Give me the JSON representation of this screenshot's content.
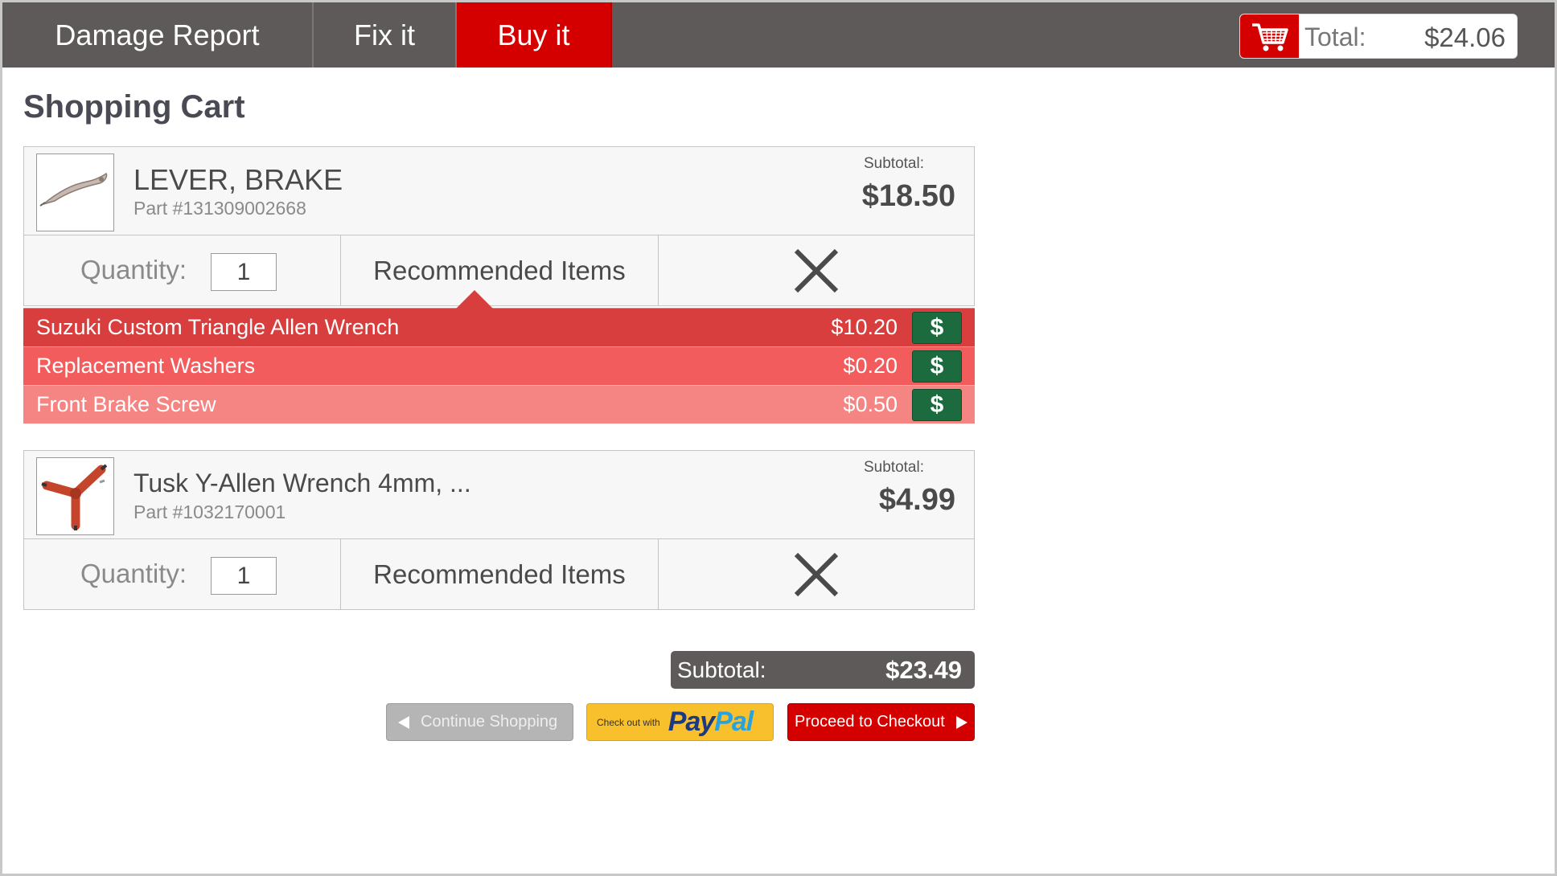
{
  "nav": {
    "tabs": [
      {
        "label": "Damage Report"
      },
      {
        "label": "Fix it"
      },
      {
        "label": "Buy it",
        "active": true
      }
    ]
  },
  "cart_summary": {
    "icon": "shopping-cart-icon",
    "label": "Total:",
    "value": "$24.06"
  },
  "page": {
    "title": "Shopping Cart"
  },
  "items": [
    {
      "name": "LEVER, BRAKE",
      "part": "Part #131309002668",
      "subtotal_label": "Subtotal:",
      "subtotal": "$18.50",
      "quantity_label": "Quantity:",
      "quantity": "1",
      "recommended_label": "Recommended Items",
      "image": "brake-lever-image"
    },
    {
      "name": "Tusk Y-Allen Wrench 4mm, ...",
      "part": "Part #1032170001",
      "subtotal_label": "Subtotal:",
      "subtotal": "$4.99",
      "quantity_label": "Quantity:",
      "quantity": "1",
      "recommended_label": "Recommended Items",
      "image": "y-allen-wrench-image"
    }
  ],
  "recommended": [
    {
      "name": "Suzuki Custom Triangle Allen Wrench",
      "price": "$10.20",
      "buy": "$",
      "color": "#d93e3e"
    },
    {
      "name": "Replacement Washers",
      "price": "$0.20",
      "buy": "$",
      "color": "#f25c5c"
    },
    {
      "name": "Front Brake Screw",
      "price": "$0.50",
      "buy": "$",
      "color": "#f58583"
    }
  ],
  "summary": {
    "label": "Subtotal:",
    "value": "$23.49"
  },
  "actions": {
    "continue": "Continue Shopping",
    "paypal_prefix": "Check out with",
    "paypal_pay": "Pay",
    "paypal_pal": "Pal",
    "checkout": "Proceed to Checkout"
  },
  "colors": {
    "brand_red": "#d40000",
    "topbar": "#5e5a59",
    "buy_green": "#1b6b3f",
    "paypal_yellow": "#f7c02c"
  }
}
